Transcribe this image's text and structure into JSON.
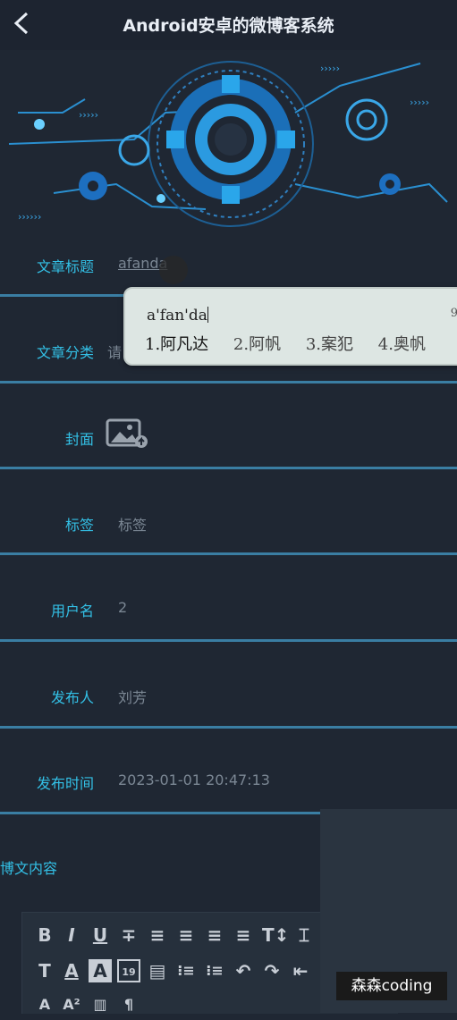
{
  "header": {
    "title": "Android安卓的微博客系统",
    "back_icon": "chevron-left-icon"
  },
  "form": {
    "title_label": "文章标题",
    "title_value": "afanda",
    "category_label": "文章分类",
    "category_placeholder": "请",
    "cover_label": "封面",
    "tags_label": "标签",
    "tags_placeholder": "标签",
    "username_label": "用户名",
    "username_value": "2",
    "publisher_label": "发布人",
    "publisher_value": "刘芳",
    "publish_time_label": "发布时间",
    "publish_time_value": "2023-01-01 20:47:13",
    "content_label": "博文内容"
  },
  "ime": {
    "pinyin": "a'fan'da",
    "corner": "9",
    "candidates": [
      "1.阿凡达",
      "2.阿帆",
      "3.案犯",
      "4.奥帆"
    ]
  },
  "editor_toolbar": {
    "row1": [
      "B",
      "I",
      "U",
      "∓",
      "≡",
      "≡",
      "≡",
      "≡",
      "T↕",
      "⌶"
    ],
    "row2": [
      "T",
      "A",
      "A",
      "19",
      "▤",
      "⁝≡",
      "⁝≡",
      "↶",
      "↷",
      "⇤"
    ],
    "row3": [
      "A",
      "A²",
      "▥",
      "¶"
    ]
  },
  "watermark": "森森coding",
  "colors": {
    "accent": "#33c0e6",
    "divider": "#3a7ea3",
    "background": "#1f2733"
  }
}
